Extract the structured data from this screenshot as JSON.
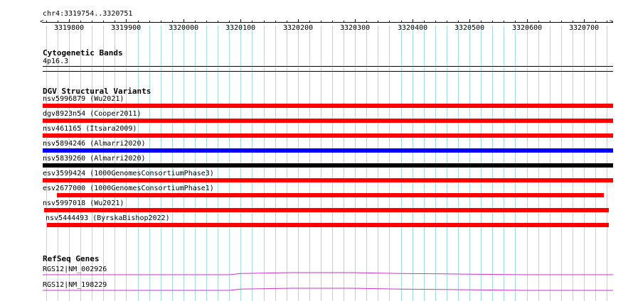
{
  "ruler": {
    "range_label": "chr4:3319754..3320751",
    "start": 3319754,
    "end": 3320751,
    "tick_labels": [
      "3319800",
      "3319900",
      "3320000",
      "3320100",
      "3320200",
      "3320300",
      "3320400",
      "3320500",
      "3320600",
      "3320700"
    ]
  },
  "cytoband": {
    "title": "Cytogenetic Bands",
    "band": "4p16.3"
  },
  "dgv": {
    "title": "DGV Structural Variants",
    "variants": [
      {
        "label": "nsv5996879 (Wu2021)",
        "color": "#ff0000",
        "start": 3319754,
        "end": 3320751
      },
      {
        "label": "dgv8923n54 (Cooper2011)",
        "color": "#ff0000",
        "start": 3319754,
        "end": 3320751
      },
      {
        "label": "nsv461165 (Itsara2009)",
        "color": "#ff0000",
        "start": 3319754,
        "end": 3320751
      },
      {
        "label": "nsv5894246 (Almarri2020)",
        "color": "#0000ff",
        "start": 3319754,
        "end": 3320751
      },
      {
        "label": "nsv5839260 (Almarri2020)",
        "color": "#000000",
        "start": 3319754,
        "end": 3320751
      },
      {
        "label": "esv3599424 (1000GenomesConsortiumPhase3)",
        "color": "#ff0000",
        "start": 3319754,
        "end": 3320751
      },
      {
        "label": "esv2677000 (1000GenomesConsortiumPhase1)",
        "color": "#ff0000",
        "start": 3319779,
        "end": 3320735
      },
      {
        "label": "nsv5997018 (Wu2021)",
        "color": "#ff0000",
        "start": 3319756,
        "end": 3320743
      },
      {
        "label": "nsv5444493 (ByrskaBishop2022)",
        "color": "#ff0000",
        "start": 3319761,
        "end": 3320743
      }
    ]
  },
  "refseq": {
    "title": "RefSeq Genes",
    "genes": [
      {
        "label": "RGS12|NM_002926",
        "color": "#cc33cc"
      },
      {
        "label": "RGS12|NM_198229",
        "color": "#cc33cc"
      }
    ]
  }
}
